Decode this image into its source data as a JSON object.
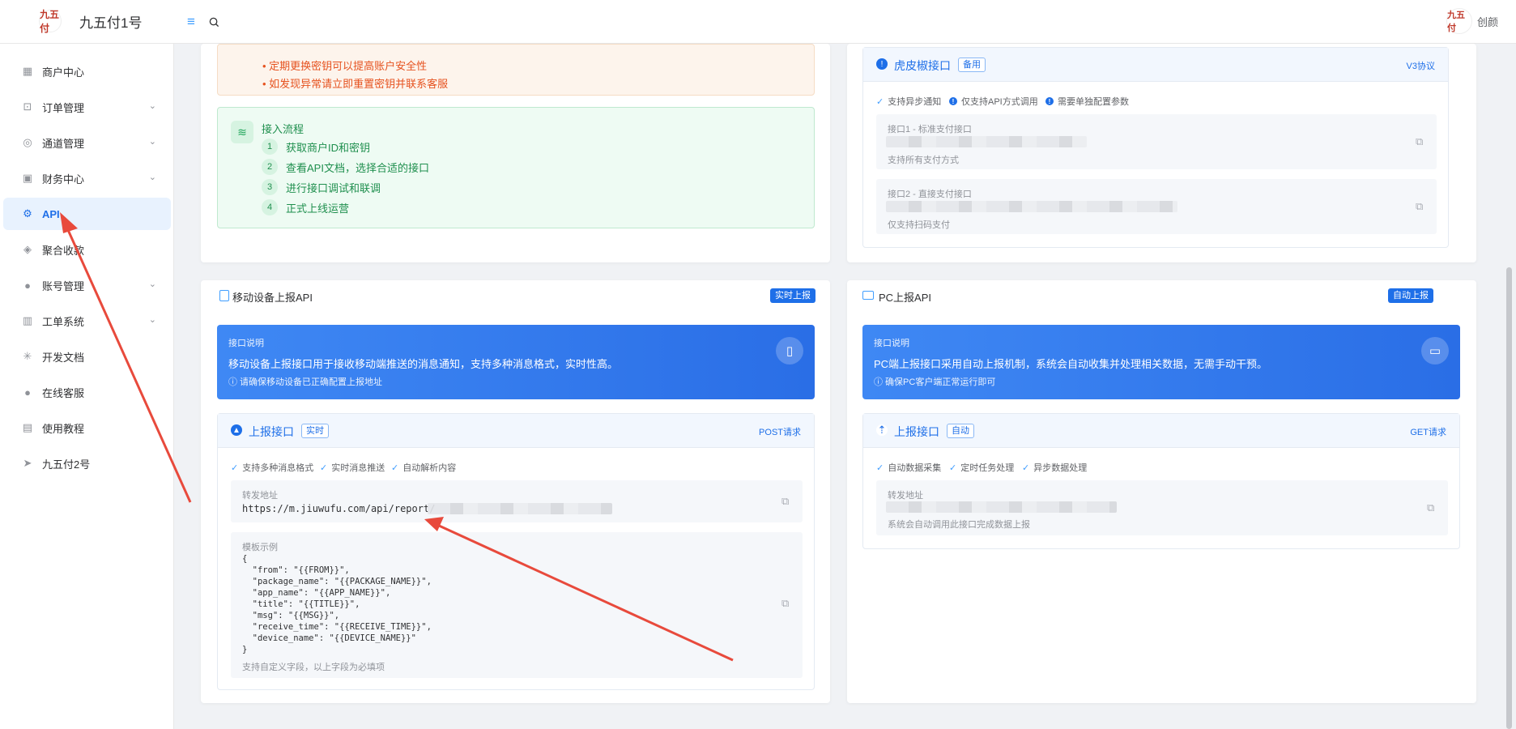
{
  "header": {
    "logo_text": "九五付",
    "brand": "九五付1号",
    "user_avatar_text": "九五付",
    "user_name": "创颜"
  },
  "sidebar": {
    "items": [
      {
        "label": "商户中心",
        "icon": "grid-icon",
        "chevron": false
      },
      {
        "label": "订单管理",
        "icon": "bag-icon",
        "chevron": true
      },
      {
        "label": "通道管理",
        "icon": "target-icon",
        "chevron": true
      },
      {
        "label": "财务中心",
        "icon": "id-card-icon",
        "chevron": true
      },
      {
        "label": "API",
        "icon": "chip-icon",
        "chevron": false,
        "active": true
      },
      {
        "label": "聚合收款",
        "icon": "stack-icon",
        "chevron": false
      },
      {
        "label": "账号管理",
        "icon": "user-icon",
        "chevron": true
      },
      {
        "label": "工单系统",
        "icon": "book-icon",
        "chevron": true
      },
      {
        "label": "开发文档",
        "icon": "loader-icon",
        "chevron": false
      },
      {
        "label": "在线客服",
        "icon": "user-icon",
        "chevron": false
      },
      {
        "label": "使用教程",
        "icon": "doc-icon",
        "chevron": false
      },
      {
        "label": "九五付2号",
        "icon": "send-icon",
        "chevron": false
      }
    ]
  },
  "tips": {
    "lines": [
      "定期更换密钥可以提高账户安全性",
      "如发现异常请立即重置密钥并联系客服"
    ]
  },
  "flow": {
    "title": "接入流程",
    "steps": [
      "获取商户ID和密钥",
      "查看API文档，选择合适的接口",
      "进行接口调试和联调",
      "正式上线运营"
    ]
  },
  "backup_panel": {
    "title": "虎皮椒接口",
    "tag": "备用",
    "protocol": "V3协议",
    "features": [
      "支持异步通知",
      "仅支持API方式调用",
      "需要单独配置参数"
    ],
    "endpoint1": {
      "label": "接口1 - 标准支付接口",
      "note": "支持所有支付方式"
    },
    "endpoint2": {
      "label": "接口2 - 直接支付接口",
      "note": "仅支持扫码支付"
    }
  },
  "mobile": {
    "title": "移动设备上报API",
    "badge": "实时上报",
    "banner": {
      "label": "接口说明",
      "text": "移动设备上报接口用于接收移动端推送的消息通知，支持多种消息格式，实时性高。",
      "note": "ⓘ 请确保移动设备已正确配置上报地址"
    },
    "report": {
      "title": "上报接口",
      "tag": "实时",
      "method": "POST请求",
      "features": [
        "支持多种消息格式",
        "实时消息推送",
        "自动解析内容"
      ],
      "forward_label": "转发地址",
      "forward_url": "https://m.jiuwufu.com/api/report/",
      "template_label": "模板示例",
      "template_code": "{\n  \"from\": \"{{FROM}}\",\n  \"package_name\": \"{{PACKAGE_NAME}}\",\n  \"app_name\": \"{{APP_NAME}}\",\n  \"title\": \"{{TITLE}}\",\n  \"msg\": \"{{MSG}}\",\n  \"receive_time\": \"{{RECEIVE_TIME}}\",\n  \"device_name\": \"{{DEVICE_NAME}}\"\n}",
      "template_note": "支持自定义字段，以上字段为必填项"
    }
  },
  "pc": {
    "title": "PC上报API",
    "badge": "自动上报",
    "banner": {
      "label": "接口说明",
      "text": "PC端上报接口采用自动上报机制，系统会自动收集并处理相关数据，无需手动干预。",
      "note": "ⓘ 确保PC客户端正常运行即可"
    },
    "report": {
      "title": "上报接口",
      "tag": "自动",
      "method": "GET请求",
      "features": [
        "自动数据采集",
        "定时任务处理",
        "异步数据处理"
      ],
      "forward_label": "转发地址",
      "forward_note": "系统会自动调用此接口完成数据上报"
    }
  },
  "colors": {
    "accent": "#1e6fe8",
    "warning": "#e6521f",
    "success": "#1f8f4e",
    "annotation": "#e84a3c"
  }
}
